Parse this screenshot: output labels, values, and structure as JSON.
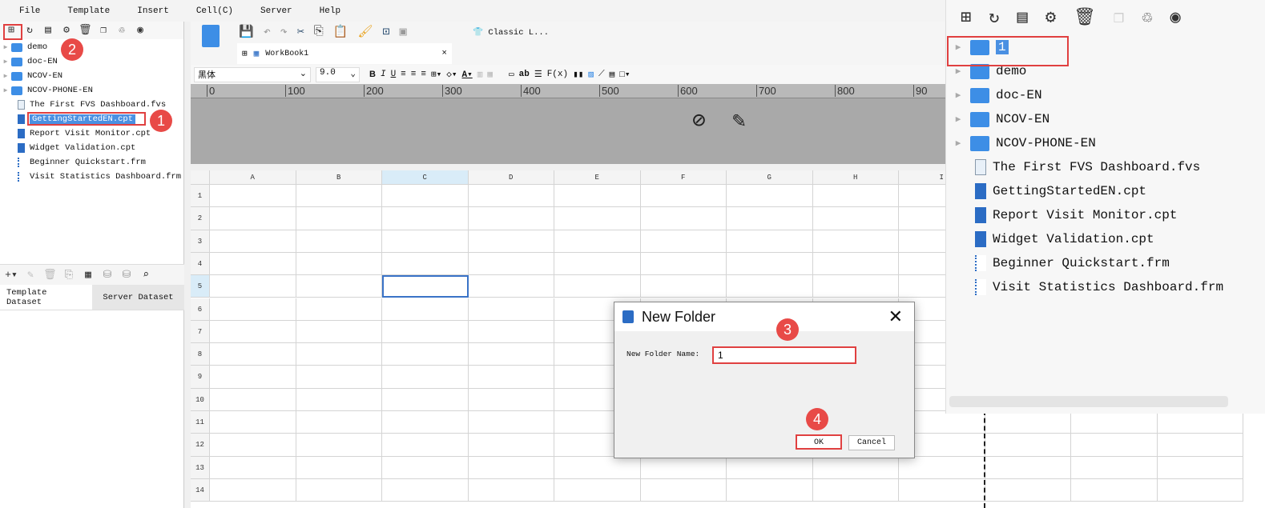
{
  "menu": [
    "File",
    "Template",
    "Insert",
    "Cell(C)",
    "Server",
    "Help"
  ],
  "tree": [
    {
      "type": "folder",
      "label": "demo"
    },
    {
      "type": "folder",
      "label": "doc-EN"
    },
    {
      "type": "folder",
      "label": "NCOV-EN"
    },
    {
      "type": "folder",
      "label": "NCOV-PHONE-EN"
    },
    {
      "type": "fvs",
      "label": "The First FVS Dashboard.fvs"
    },
    {
      "type": "cpt",
      "label": "GettingStartedEN.cpt"
    },
    {
      "type": "cpt",
      "label": "Report Visit Monitor.cpt"
    },
    {
      "type": "cpt",
      "label": "Widget Validation.cpt"
    },
    {
      "type": "frm",
      "label": "Beginner Quickstart.frm"
    },
    {
      "type": "frm",
      "label": "Visit Statistics Dashboard.frm"
    }
  ],
  "dataset_tabs": {
    "template": "Template Dataset",
    "server": "Server Dataset"
  },
  "toolbar": {
    "style_label": "Classic L...",
    "tab_label": "WorkBook1",
    "font": "黑体",
    "size": "9.0"
  },
  "ruler_ticks": [
    "0",
    "100",
    "200",
    "300",
    "400",
    "500",
    "600",
    "700",
    "800",
    "90"
  ],
  "columns": [
    "A",
    "B",
    "C",
    "D",
    "E",
    "F",
    "G",
    "H",
    "I"
  ],
  "rows": [
    "1",
    "2",
    "3",
    "4",
    "5",
    "6",
    "7",
    "8",
    "9",
    "10",
    "11",
    "12",
    "13",
    "14"
  ],
  "dialog": {
    "title": "New Folder",
    "field_label": "New Folder Name:",
    "field_value": "1",
    "ok": "OK",
    "cancel": "Cancel"
  },
  "right_tree": [
    {
      "type": "folder",
      "label": "1"
    },
    {
      "type": "folder",
      "label": "demo"
    },
    {
      "type": "folder",
      "label": "doc-EN"
    },
    {
      "type": "folder",
      "label": "NCOV-EN"
    },
    {
      "type": "folder",
      "label": "NCOV-PHONE-EN"
    },
    {
      "type": "fvs",
      "label": "The First FVS Dashboard.fvs"
    },
    {
      "type": "cpt",
      "label": "GettingStartedEN.cpt"
    },
    {
      "type": "cpt",
      "label": "Report Visit Monitor.cpt"
    },
    {
      "type": "cpt",
      "label": "Widget Validation.cpt"
    },
    {
      "type": "frm",
      "label": "Beginner Quickstart.frm"
    },
    {
      "type": "frm",
      "label": "Visit Statistics Dashboard.frm"
    }
  ],
  "steps": [
    "1",
    "2",
    "3",
    "4"
  ],
  "colors": {
    "accent": "#4a90e2",
    "annotation": "#e04040"
  }
}
